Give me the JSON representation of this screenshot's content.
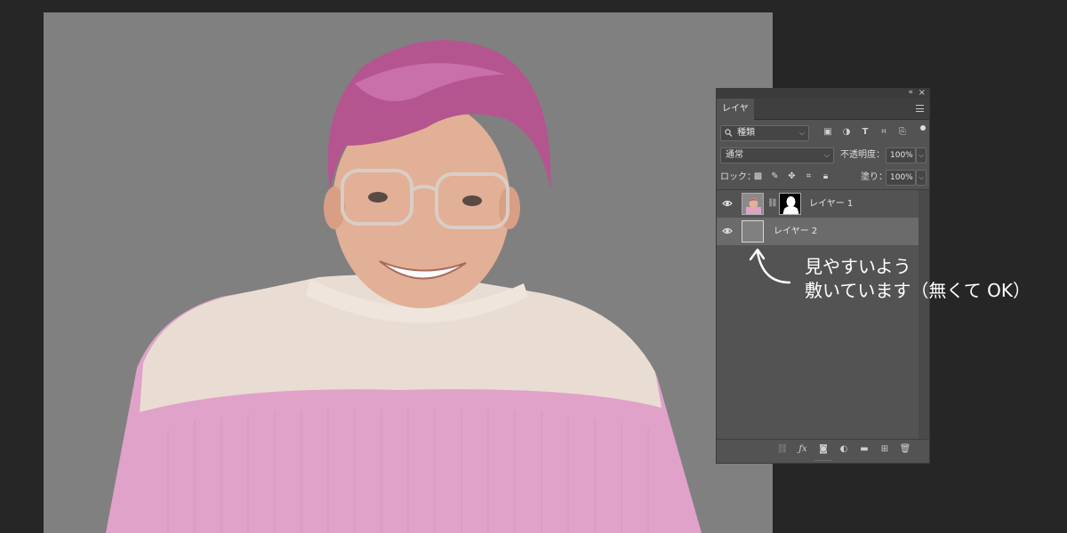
{
  "panel": {
    "collapse_glyph": "«",
    "close_glyph": "×",
    "tab_label": "レイヤー",
    "filter": {
      "value": "種類",
      "icon_names": [
        "image-filter-icon",
        "adjustment-filter-icon",
        "type-filter-icon",
        "shape-filter-icon",
        "smart-object-filter-icon"
      ]
    },
    "blend_mode": "通常",
    "opacity_label": "不透明度：",
    "opacity_value": "100%",
    "lock_label": "ロック：",
    "fill_label": "塗り：",
    "fill_value": "100%",
    "layers": [
      {
        "name": "レイヤー 1",
        "visible": true,
        "has_mask": true
      },
      {
        "name": "レイヤー 2",
        "visible": true,
        "selected": true
      }
    ]
  },
  "annotation": {
    "line1": "見やすいよう",
    "line2": "敷いています（無くて OK）"
  },
  "colors": {
    "app_bg": "#262626",
    "canvas_bg": "#808080",
    "panel_bg": "#535353",
    "selected_layer": "#6b6b6b",
    "sweater_pink": "#e0a2c8",
    "sweater_cream": "#e8dcd4",
    "hair": "#b5558f"
  }
}
